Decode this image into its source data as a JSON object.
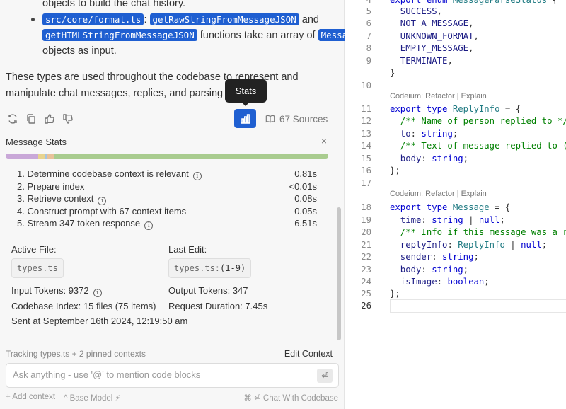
{
  "chat": {
    "bullet_partial": "objects to build the chat history.",
    "bullet": {
      "chip_file": "src/core/format.ts",
      "sep": ":",
      "chip_fn1": "getRawStringFromMessageJSON",
      "and": "and",
      "chip_fn2": "getHTMLStringFromMessageJSON",
      "mid": "functions take an array of",
      "chip_type": "Message",
      "end": "objects as input."
    },
    "paragraph": "These types are used throughout the codebase to represent and manipulate chat messages, replies, and parsing status.",
    "tooltip": "Stats",
    "action_icons": [
      "refresh-icon",
      "copy-icon",
      "thumbs-up-icon",
      "thumbs-down-icon"
    ],
    "sources_label": "67 Sources"
  },
  "stats": {
    "title": "Message Stats",
    "close": "×",
    "bar_segments": [
      {
        "color": "#c9a8d8",
        "share": 0.1
      },
      {
        "color": "#e8d48f",
        "share": 0.02
      },
      {
        "color": "#a7c4e0",
        "share": 0.01
      },
      {
        "color": "#e8c29a",
        "share": 0.02
      },
      {
        "color": "#a9cc8f",
        "share": 0.85
      }
    ],
    "steps": [
      {
        "label": "1. Determine codebase context is relevant",
        "value": "0.81s",
        "info": true
      },
      {
        "label": "2. Prepare index",
        "value": "<0.01s",
        "info": false
      },
      {
        "label": "3. Retrieve context",
        "value": "0.08s",
        "info": true
      },
      {
        "label": "4. Construct prompt with 67 context items",
        "value": "0.05s",
        "info": false
      },
      {
        "label": "5. Stream 347 token response",
        "value": "6.51s",
        "info": true
      }
    ],
    "active_file_label": "Active File:",
    "active_file": "types.ts",
    "last_edit_label": "Last Edit:",
    "last_edit_file": "types.ts:",
    "last_edit_range": "(1-9)",
    "input_tokens": "Input Tokens: 9372",
    "output_tokens": "Output Tokens: 347",
    "codebase_index": "Codebase Index: 15 files (75 items)",
    "request_duration": "Request Duration: 7.45s",
    "sent_at": "Sent at September 16th 2024, 12:19:50 am"
  },
  "footer": {
    "tracking": "Tracking types.ts + 2 pinned contexts",
    "edit_context": "Edit Context",
    "input_placeholder": "Ask anything - use '@' to mention code blocks",
    "enter_symbol": "⏎",
    "add_context": "+ Add context",
    "base_model": "^ Base Model ⚡",
    "chat_with_codebase": "⌘ ⏎  Chat With Codebase"
  },
  "editor": {
    "lens_text": "Codeium: Refactor | Explain",
    "active_line": "26",
    "lines": [
      {
        "n": "4",
        "parts": [
          [
            "kw",
            "export "
          ],
          [
            "kw",
            "enum "
          ],
          [
            "ty",
            "MessageParseStatus "
          ],
          [
            "pu",
            "{"
          ]
        ]
      },
      {
        "n": "5",
        "parts": [
          [
            "",
            "  SUCCESS"
          ],
          [
            "pu",
            ","
          ]
        ]
      },
      {
        "n": "6",
        "parts": [
          [
            "",
            "  NOT_A_MESSAGE"
          ],
          [
            "pu",
            ","
          ]
        ]
      },
      {
        "n": "7",
        "parts": [
          [
            "",
            "  UNKNOWN_FORMAT"
          ],
          [
            "pu",
            ","
          ]
        ]
      },
      {
        "n": "8",
        "parts": [
          [
            "",
            "  EMPTY_MESSAGE"
          ],
          [
            "pu",
            ","
          ]
        ]
      },
      {
        "n": "9",
        "parts": [
          [
            "",
            "  TERMINATE"
          ],
          [
            "pu",
            ","
          ]
        ]
      },
      {
        "n": "",
        "parts": [
          [
            "pu",
            "}"
          ]
        ]
      },
      {
        "n": "10",
        "parts": []
      },
      {
        "n": "11",
        "parts": [
          [
            "kw",
            "export "
          ],
          [
            "kw",
            "type "
          ],
          [
            "ty",
            "ReplyInfo "
          ],
          [
            "pu",
            "= {"
          ]
        ]
      },
      {
        "n": "12",
        "parts": [
          [
            "cm",
            "  /** Name of person replied to */"
          ]
        ]
      },
      {
        "n": "13",
        "parts": [
          [
            "",
            "  to"
          ],
          [
            "pu",
            ": "
          ],
          [
            "kw",
            "string"
          ],
          [
            "pu",
            ";"
          ]
        ]
      },
      {
        "n": "14",
        "parts": [
          [
            "cm",
            "  /** Text of message replied to (or"
          ]
        ]
      },
      {
        "n": "15",
        "parts": [
          [
            "",
            "  body"
          ],
          [
            "pu",
            ": "
          ],
          [
            "kw",
            "string"
          ],
          [
            "pu",
            ";"
          ]
        ]
      },
      {
        "n": "16",
        "parts": [
          [
            "pu",
            "};"
          ]
        ]
      },
      {
        "n": "17",
        "parts": []
      },
      {
        "n": "18",
        "parts": [
          [
            "kw",
            "export "
          ],
          [
            "kw",
            "type "
          ],
          [
            "ty",
            "Message "
          ],
          [
            "pu",
            "= {"
          ]
        ]
      },
      {
        "n": "19",
        "parts": [
          [
            "",
            "  time"
          ],
          [
            "pu",
            ": "
          ],
          [
            "kw",
            "string "
          ],
          [
            "pu",
            "| "
          ],
          [
            "kw",
            "null"
          ],
          [
            "pu",
            ";"
          ]
        ]
      },
      {
        "n": "20",
        "parts": [
          [
            "cm",
            "  /** Info if this message was a rep"
          ]
        ]
      },
      {
        "n": "21",
        "parts": [
          [
            "",
            "  replyInfo"
          ],
          [
            "pu",
            ": "
          ],
          [
            "ty",
            "ReplyInfo "
          ],
          [
            "pu",
            "| "
          ],
          [
            "kw",
            "null"
          ],
          [
            "pu",
            ";"
          ]
        ]
      },
      {
        "n": "22",
        "parts": [
          [
            "",
            "  sender"
          ],
          [
            "pu",
            ": "
          ],
          [
            "kw",
            "string"
          ],
          [
            "pu",
            ";"
          ]
        ]
      },
      {
        "n": "23",
        "parts": [
          [
            "",
            "  body"
          ],
          [
            "pu",
            ": "
          ],
          [
            "kw",
            "string"
          ],
          [
            "pu",
            ";"
          ]
        ]
      },
      {
        "n": "24",
        "parts": [
          [
            "",
            "  isImage"
          ],
          [
            "pu",
            ": "
          ],
          [
            "kw",
            "boolean"
          ],
          [
            "pu",
            ";"
          ]
        ]
      },
      {
        "n": "25",
        "parts": [
          [
            "pu",
            "};"
          ]
        ]
      },
      {
        "n": "26",
        "parts": []
      }
    ]
  }
}
